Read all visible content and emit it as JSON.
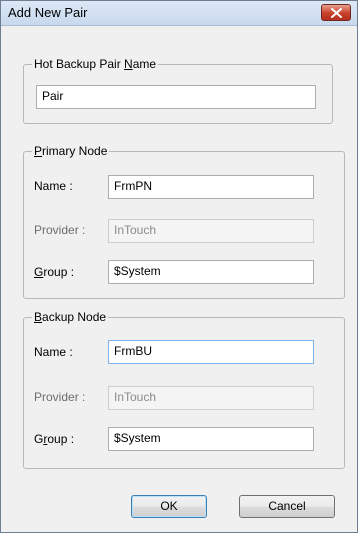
{
  "window": {
    "title": "Add New Pair"
  },
  "pair_name_group": {
    "legend_pre": "Hot Backup Pair ",
    "legend_u": "N",
    "legend_post": "ame",
    "value": "Pair"
  },
  "primary": {
    "legend_u": "P",
    "legend_post": "rimary Node",
    "name_label": "Name :",
    "name_value": "FrmPN",
    "provider_label": "Provider :",
    "provider_value": "InTouch",
    "group_label_u": "G",
    "group_label_post": "roup :",
    "group_value": "$System"
  },
  "backup": {
    "legend_u": "B",
    "legend_post": "ackup Node",
    "name_label": "Name :",
    "name_value": "FrmBU",
    "provider_label": "Provider :",
    "provider_value": "InTouch",
    "group_label_pre": "G",
    "group_label_u": "r",
    "group_label_post": "oup :",
    "group_value": "$System"
  },
  "buttons": {
    "ok": "OK",
    "cancel": "Cancel"
  }
}
